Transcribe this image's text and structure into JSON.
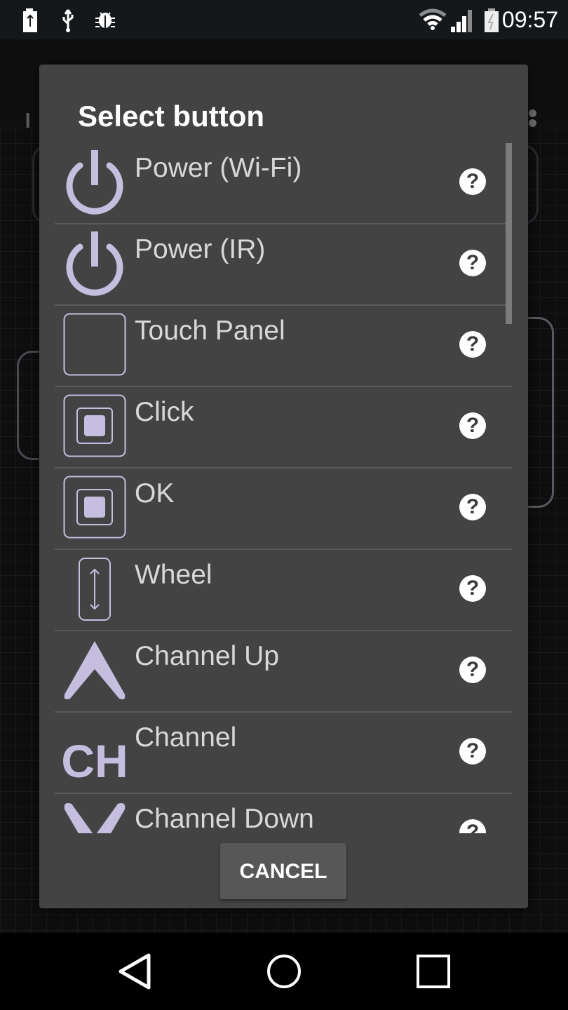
{
  "status_bar": {
    "left_icons": [
      "battery-charging-icon",
      "usb-icon",
      "debug-bug-icon"
    ],
    "right_icons": [
      "wifi-icon",
      "cell-signal-icon",
      "battery-icon"
    ],
    "time": "09:57"
  },
  "background_app": {
    "title_fragment": "L",
    "overflow_menu_icon": "overflow-menu-icon"
  },
  "dialog": {
    "title": "Select button",
    "items": [
      {
        "label": "Power (Wi-Fi)",
        "icon": "power-icon"
      },
      {
        "label": "Power (IR)",
        "icon": "power-icon"
      },
      {
        "label": "Touch Panel",
        "icon": "touch-panel-icon"
      },
      {
        "label": "Click",
        "icon": "click-button-icon"
      },
      {
        "label": "OK",
        "icon": "ok-button-icon"
      },
      {
        "label": "Wheel",
        "icon": "wheel-icon"
      },
      {
        "label": "Channel Up",
        "icon": "chevron-up-icon"
      },
      {
        "label": "Channel",
        "icon": "channel-ch-icon",
        "icon_text": "CH"
      },
      {
        "label": "Channel Down",
        "icon": "chevron-down-icon"
      }
    ],
    "help_glyph": "?",
    "cancel_label": "CANCEL"
  },
  "colors": {
    "accent": "#c6bedf",
    "dialog_bg": "#434343",
    "text": "#d8d8d8"
  },
  "nav_bar": {
    "buttons": [
      "back-icon",
      "home-icon",
      "recents-icon"
    ]
  }
}
